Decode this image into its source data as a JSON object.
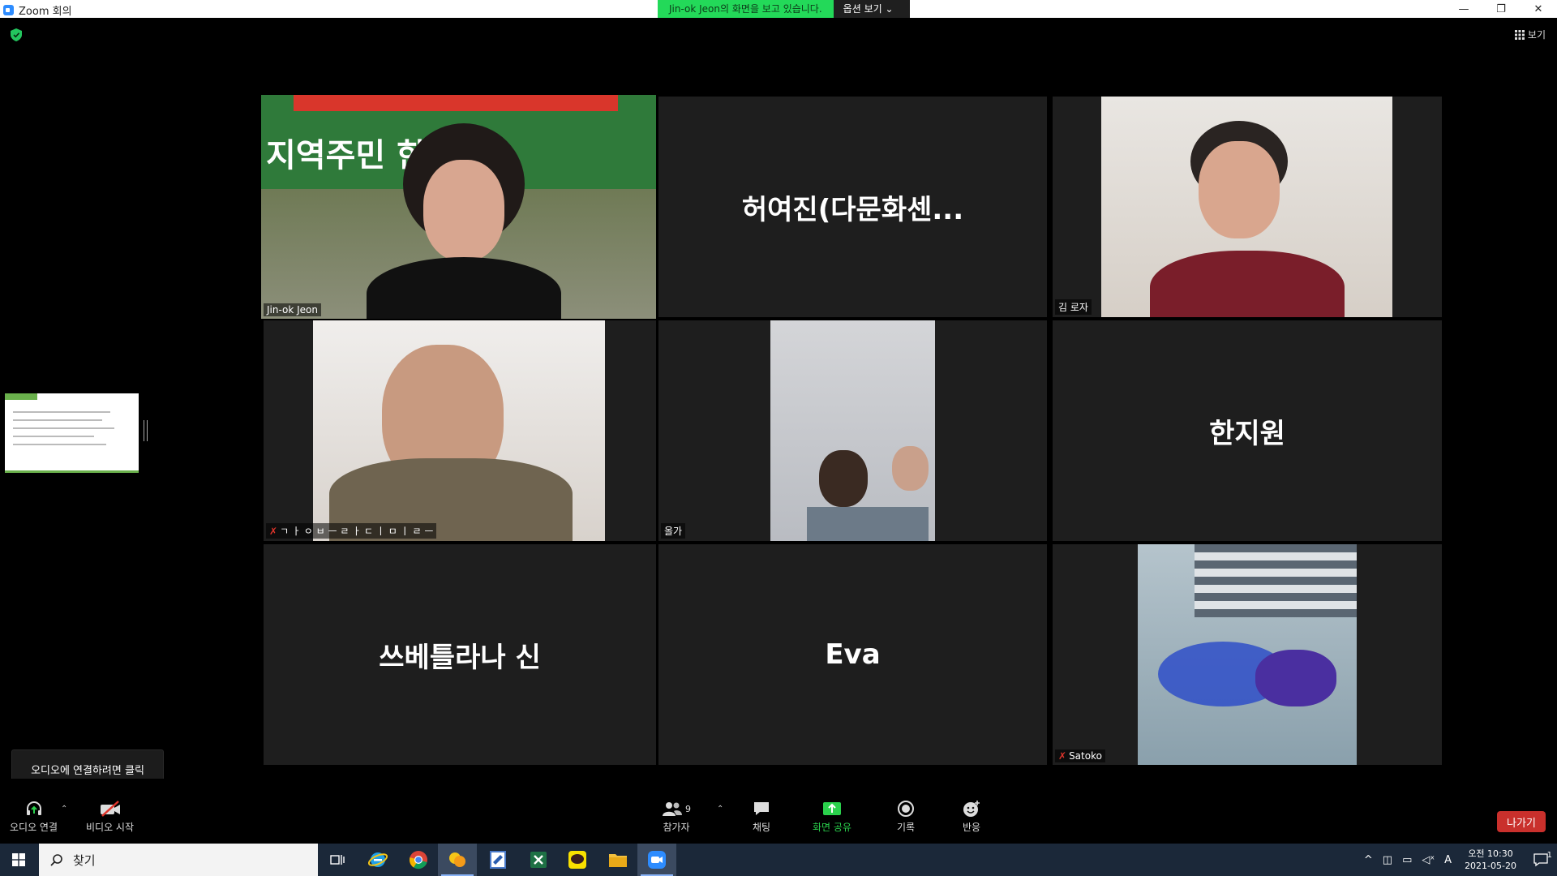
{
  "titlebar": {
    "title": "Zoom 회의",
    "share_message": "Jin-ok Jeon의 화면을 보고 있습니다.",
    "options_label": "옵션 보기 ⌄"
  },
  "window_controls": {
    "minimize": "—",
    "restore": "❐",
    "close": "✕"
  },
  "view_button": {
    "label": "보기"
  },
  "participants": [
    {
      "name": "Jin-ok Jeon",
      "type": "video",
      "active_speaker": true
    },
    {
      "name": "허여진(다문화센...",
      "type": "name_only"
    },
    {
      "name": "김 로자",
      "type": "video"
    },
    {
      "name": "ㄱ ㅏ ㅇ ㅂ ㅡ ㄹ ㅏ ㄷ ㅣ ㅁ ㅣ ㄹ ㅡ",
      "type": "video",
      "muted": true
    },
    {
      "name": "올가",
      "type": "video"
    },
    {
      "name": "한지원",
      "type": "name_only"
    },
    {
      "name": "쓰베틀라나 신",
      "type": "name_only"
    },
    {
      "name": "Eva",
      "type": "name_only"
    },
    {
      "name": "Satoko",
      "type": "video",
      "muted": true
    }
  ],
  "slide_banner": {
    "text": "지역주민 한국"
  },
  "audio_tooltip": "오디오에 연결하려면 클릭",
  "toolbar": {
    "audio_label": "오디오 연결",
    "video_label": "비디오 시작",
    "participants_label": "참가자",
    "participants_count": "9",
    "chat_label": "채팅",
    "share_label": "화면 공유",
    "record_label": "기록",
    "reactions_label": "반응",
    "leave_label": "나가기"
  },
  "taskbar": {
    "search_placeholder": "찾기",
    "clock_time": "오전 10:30",
    "clock_date": "2021-05-20",
    "ime_label": "A",
    "notification_count": "1"
  },
  "colors": {
    "active_border": "#e9e936",
    "share_green": "#23d959",
    "leave_red": "#c9302c",
    "taskbar": "#1b2839"
  }
}
